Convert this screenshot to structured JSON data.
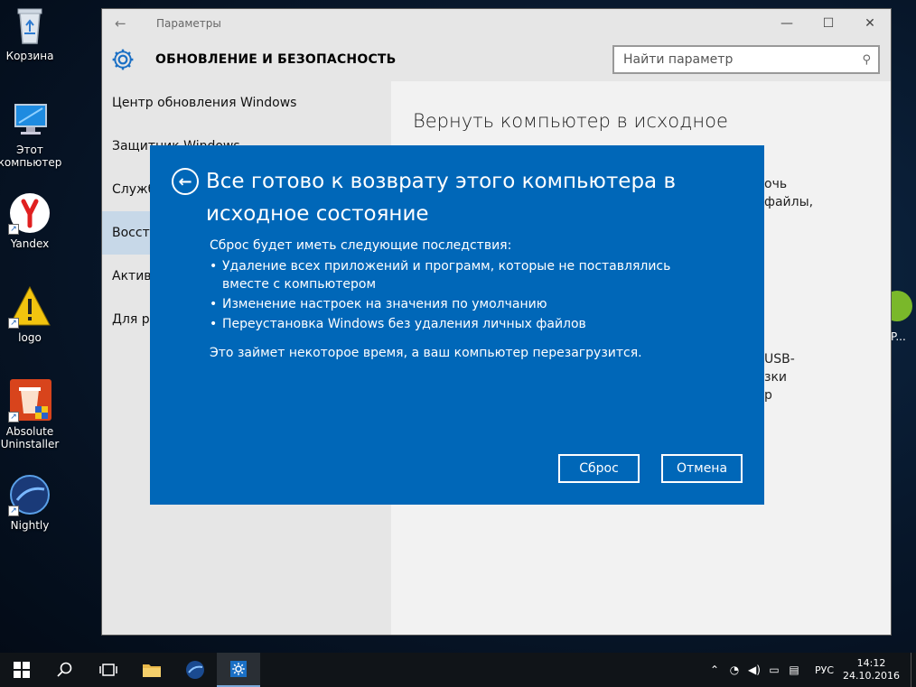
{
  "desktop": {
    "icons": [
      {
        "label": "Корзина"
      },
      {
        "label": "Этот компьютер"
      },
      {
        "label": "Yandex"
      },
      {
        "label": "logo"
      },
      {
        "label": "Absolute Uninstaller"
      },
      {
        "label": "Nightly"
      }
    ],
    "peek_right_label": "P..."
  },
  "window": {
    "title": "Параметры",
    "controls": {
      "minimize": "—",
      "maximize": "☐",
      "close": "✕"
    },
    "header_title": "ОБНОВЛЕНИЕ И БЕЗОПАСНОСТЬ",
    "search_placeholder": "Найти параметр",
    "nav": [
      {
        "label": "Центр обновления Windows"
      },
      {
        "label": "Защитник Windows"
      },
      {
        "label": "Служба архивации"
      },
      {
        "label": "Восстановление"
      },
      {
        "label": "Активация"
      },
      {
        "label": "Для разработчиков"
      }
    ],
    "content_title": "Вернуть компьютер в исходное состояние",
    "peek": [
      "очь",
      "файлы,",
      "USB-",
      "зки",
      "р"
    ]
  },
  "dialog": {
    "title": "Все готово к возврату этого компьютера в исходное состояние",
    "intro": "Сброс будет иметь следующие последствия:",
    "bullets": [
      "Удаление всех приложений и программ, которые не поставлялись вместе с компьютером",
      "Изменение настроек на значения по умолчанию",
      "Переустановка Windows без удаления личных файлов"
    ],
    "note": "Это займет некоторое время, а ваш компьютер перезагрузится.",
    "reset_button": "Сброс",
    "cancel_button": "Отмена",
    "accent": "#0067b8"
  },
  "taskbar": {
    "icons": [
      "windows-icon",
      "search-icon",
      "task-view-icon",
      "file-explorer-icon",
      "nightly-icon",
      "settings-icon"
    ],
    "language": "РУС",
    "time": "14:12",
    "date": "24.10.2016"
  }
}
